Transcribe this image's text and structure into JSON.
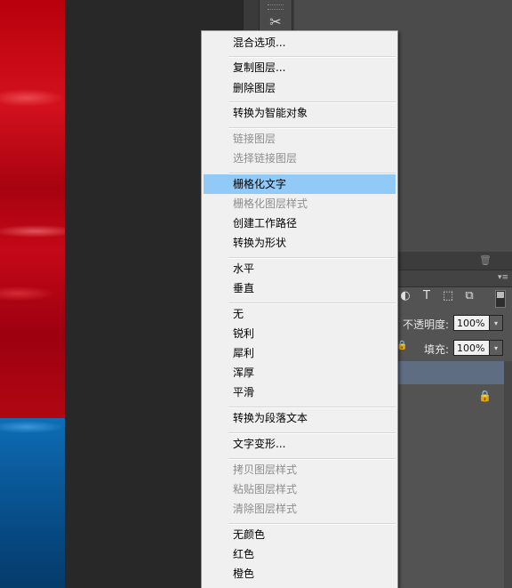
{
  "document": {
    "opacity_label": "不透明度:",
    "opacity_value": "100%",
    "fill_label": "填充:",
    "fill_value": "100%"
  },
  "context_menu": {
    "highlighted_index": 6,
    "items": [
      {
        "label": "混合选项...",
        "enabled": true
      },
      {
        "label": "复制图层...",
        "enabled": true
      },
      {
        "label": "删除图层",
        "enabled": true
      },
      {
        "label": "转换为智能对象",
        "enabled": true
      },
      {
        "label": "链接图层",
        "enabled": false
      },
      {
        "label": "选择链接图层",
        "enabled": false
      },
      {
        "label": "栅格化文字",
        "enabled": true
      },
      {
        "label": "栅格化图层样式",
        "enabled": false
      },
      {
        "label": "创建工作路径",
        "enabled": true
      },
      {
        "label": "转换为形状",
        "enabled": true
      },
      {
        "label": "水平",
        "enabled": true
      },
      {
        "label": "垂直",
        "enabled": true
      },
      {
        "label": "无",
        "enabled": true
      },
      {
        "label": "锐利",
        "enabled": true
      },
      {
        "label": "犀利",
        "enabled": true
      },
      {
        "label": "浑厚",
        "enabled": true
      },
      {
        "label": "平滑",
        "enabled": true
      },
      {
        "label": "转换为段落文本",
        "enabled": true
      },
      {
        "label": "文字变形...",
        "enabled": true
      },
      {
        "label": "拷贝图层样式",
        "enabled": false
      },
      {
        "label": "粘贴图层样式",
        "enabled": false
      },
      {
        "label": "清除图层样式",
        "enabled": false
      },
      {
        "label": "无颜色",
        "enabled": true
      },
      {
        "label": "红色",
        "enabled": true
      },
      {
        "label": "橙色",
        "enabled": true
      }
    ]
  },
  "icons": {
    "tool": "brush-settings-icon",
    "trash": "trash-icon",
    "lock": "lock-icon",
    "layer_filters": [
      "adjustment-filter-icon",
      "type-filter-icon",
      "shape-filter-icon",
      "smart-object-filter-icon"
    ]
  },
  "colors": {
    "menu_bg": "#f0f0f0",
    "menu_highlight": "#91c9f7",
    "panel_bg": "#535353",
    "canvas_red": "#c40818",
    "canvas_blue": "#0b5c9d"
  }
}
